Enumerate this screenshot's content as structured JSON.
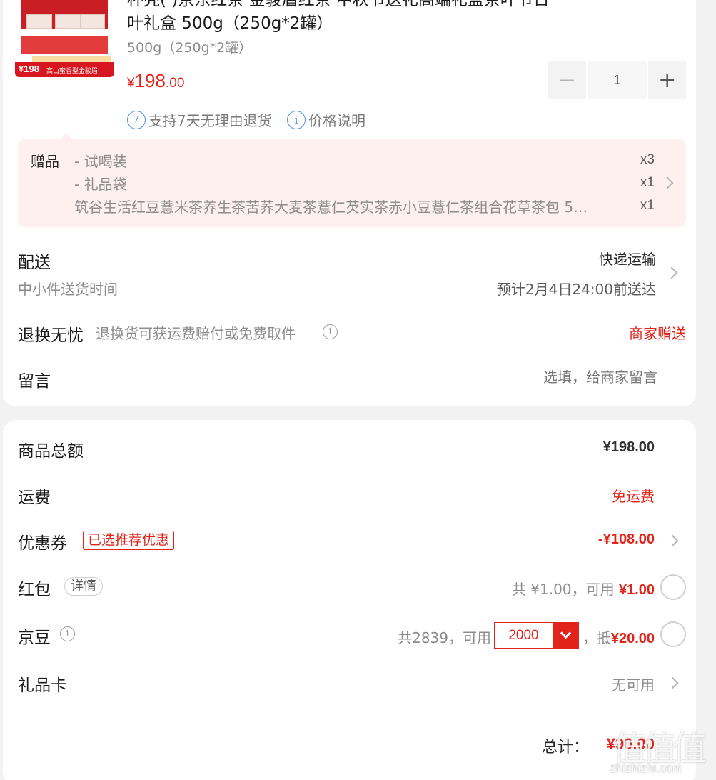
{
  "product": {
    "title_line1": "杯壳(            )京东红茶 金骏眉红茶          中秋节送礼高端礼盒茶叶节日",
    "title_line2": "叶礼盒 500g（250g*2罐）",
    "spec": "500g（250g*2罐）",
    "image_promo_price": "¥198",
    "image_promo_text": "高山蜜香型金骏眉",
    "price_symbol": "¥",
    "price_int": "198",
    "price_dec": ".00",
    "quantity": "1",
    "minus": "−",
    "plus": "+",
    "service_icon_text": "7",
    "service_text": "支持7天无理由退货",
    "price_info_icon": "i",
    "price_info_text": "价格说明"
  },
  "gifts": {
    "label": "赠品",
    "items": [
      {
        "name": "- 试喝装",
        "qty": "x3"
      },
      {
        "name": "- 礼品袋",
        "qty": "x1"
      },
      {
        "name": "筑谷生活红豆薏米茶养生茶苦荞大麦茶薏仁芡实茶赤小豆薏仁茶组合花草茶包 5…",
        "qty": "x1"
      }
    ]
  },
  "delivery": {
    "label": "配送",
    "sub": "中小件送货时间",
    "method": "快递运输",
    "eta": "预计2月4日24:00前送达"
  },
  "returns": {
    "label": "退换无忧",
    "desc": "退换货可获运费赔付或免费取件",
    "info_icon": "i",
    "value": "商家赠送"
  },
  "message": {
    "label": "留言",
    "placeholder": "选填，给商家留言"
  },
  "summary": {
    "goods_total_label": "商品总额",
    "goods_total": "¥198.00",
    "shipping_label": "运费",
    "shipping": "免运费",
    "coupon_label": "优惠券",
    "coupon_tag": "已选推荐优惠",
    "coupon_value": "-¥108.00",
    "redpacket_label": "红包",
    "redpacket_tag": "详情",
    "redpacket_total": "共 ¥1.00，可用 ",
    "redpacket_available": "¥1.00",
    "beans_label": "京豆",
    "beans_info_icon": "i",
    "beans_total": "共2839，可用",
    "beans_selected": "2000",
    "beans_deduct_prefix": "，抵",
    "beans_deduct": "¥20.00",
    "giftcard_label": "礼品卡",
    "giftcard_value": "无可用",
    "total_label": "总计：",
    "total_value": "¥90.00"
  },
  "watermark": {
    "logo": "值值值",
    "url": "zhizhizhi.com"
  },
  "colors": {
    "accent": "#e2231a",
    "gift_bg": "#fdf0ef",
    "page_bg": "#f2f2f2"
  }
}
